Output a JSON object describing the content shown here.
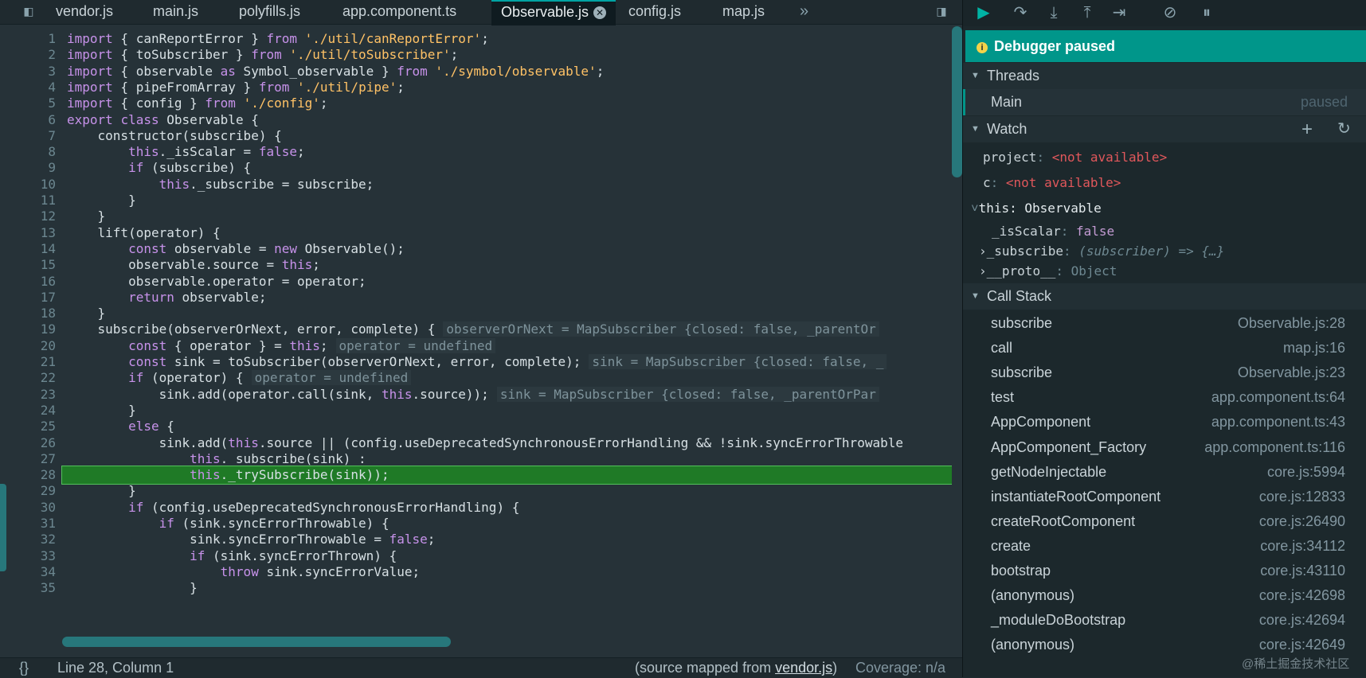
{
  "tabs": [
    "vendor.js",
    "main.js",
    "polyfills.js",
    "app.component.ts",
    "Observable.js",
    "config.js",
    "map.js"
  ],
  "tabs_more_icon": "chevron-double-right-icon",
  "code": {
    "first_line": 1,
    "highlight_line": 28,
    "lines": [
      "import { canReportError } from './util/canReportError';",
      "import { toSubscriber } from './util/toSubscriber';",
      "import { observable as Symbol_observable } from './symbol/observable';",
      "import { pipeFromArray } from './util/pipe';",
      "import { config } from './config';",
      "export class Observable {",
      "    constructor(subscribe) {",
      "        this._isScalar = false;",
      "        if (subscribe) {",
      "            this._subscribe = subscribe;",
      "        }",
      "    }",
      "    lift(operator) {",
      "        const observable = new Observable();",
      "        observable.source = this;",
      "        observable.operator = operator;",
      "        return observable;",
      "    }",
      "    subscribe(observerOrNext, error, complete) {",
      "        const { operator } = this;",
      "        const sink = toSubscriber(observerOrNext, error, complete);",
      "        if (operator) {",
      "            sink.add(operator.call(sink, this.source));",
      "        }",
      "        else {",
      "            sink.add(this.source || (config.useDeprecatedSynchronousErrorHandling && !sink.syncErrorThrowable",
      "                this._subscribe(sink) :",
      "                this._trySubscribe(sink));",
      "        }",
      "        if (config.useDeprecatedSynchronousErrorHandling) {",
      "            if (sink.syncErrorThrowable) {",
      "                sink.syncErrorThrowable = false;",
      "                if (sink.syncErrorThrown) {",
      "                    throw sink.syncErrorValue;",
      "                }"
    ],
    "inline_values": {
      "19": "observerOrNext = MapSubscriber {closed: false, _parentOr",
      "20": "operator = undefined",
      "21": "sink = MapSubscriber {closed: false, _",
      "22": "operator = undefined",
      "23": "sink = MapSubscriber {closed: false, _parentOrPar"
    }
  },
  "status": {
    "braces": "{}",
    "position": "Line 28, Column 1",
    "source_mapped_prefix": "(source mapped from ",
    "source_mapped_file": "vendor.js",
    "source_mapped_suffix": ")",
    "coverage": "Coverage: n/a"
  },
  "debugger": {
    "banner": "Debugger paused",
    "threads": {
      "title": "Threads",
      "items": [
        {
          "name": "Main",
          "state": "paused"
        }
      ]
    },
    "watch": {
      "title": "Watch",
      "items": [
        {
          "name": "project",
          "value": "<not available>"
        },
        {
          "name": "c",
          "value": "<not available>"
        }
      ],
      "this_label": "this: Observable",
      "props": [
        {
          "name": "_isScalar",
          "value": "false"
        },
        {
          "name": "_subscribe",
          "value": "(subscriber) => {…}"
        },
        {
          "name": "__proto__",
          "value": "Object"
        }
      ]
    },
    "callstack": {
      "title": "Call Stack",
      "frames": [
        {
          "fn": "subscribe",
          "loc": "Observable.js:28"
        },
        {
          "fn": "call",
          "loc": "map.js:16"
        },
        {
          "fn": "subscribe",
          "loc": "Observable.js:23"
        },
        {
          "fn": "test",
          "loc": "app.component.ts:64"
        },
        {
          "fn": "AppComponent",
          "loc": "app.component.ts:43"
        },
        {
          "fn": "AppComponent_Factory",
          "loc": "app.component.ts:116"
        },
        {
          "fn": "getNodeInjectable",
          "loc": "core.js:5994"
        },
        {
          "fn": "instantiateRootComponent",
          "loc": "core.js:12833"
        },
        {
          "fn": "createRootComponent",
          "loc": "core.js:26490"
        },
        {
          "fn": "create",
          "loc": "core.js:34112"
        },
        {
          "fn": "bootstrap",
          "loc": "core.js:43110"
        },
        {
          "fn": "(anonymous)",
          "loc": "core.js:42698"
        },
        {
          "fn": "_moduleDoBootstrap",
          "loc": "core.js:42694"
        },
        {
          "fn": "(anonymous)",
          "loc": "core.js:42649"
        }
      ]
    }
  },
  "watermark": "@稀土掘金技术社区",
  "colors": {
    "accent": "#00968a",
    "highlight_line": "#1f7a26",
    "error_text": "#e0575b"
  }
}
